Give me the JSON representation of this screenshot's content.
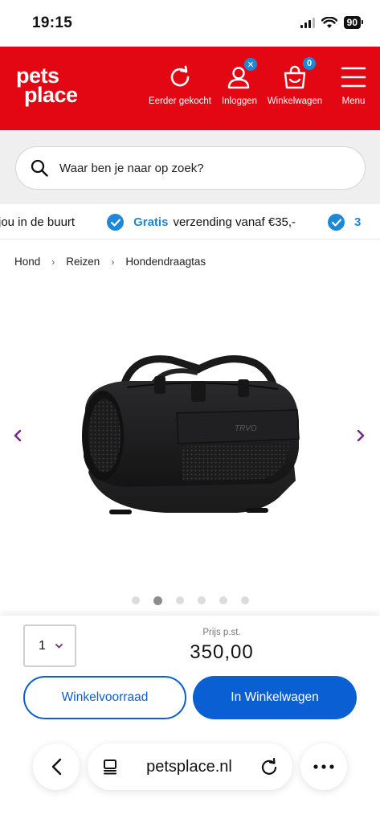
{
  "status_bar": {
    "time": "19:15",
    "battery": "90"
  },
  "header": {
    "logo_line1": "pets",
    "logo_line2": "place",
    "items": [
      {
        "label": "Eerder gekocht",
        "icon": "refresh-icon"
      },
      {
        "label": "Inloggen",
        "icon": "user-icon",
        "badge": "✕"
      },
      {
        "label": "Winkelwagen",
        "icon": "bag-icon",
        "badge": "0"
      },
      {
        "label": "Menu",
        "icon": "hamburger-icon"
      }
    ],
    "brand_color": "#e30613",
    "badge_color": "#1e88d8"
  },
  "search": {
    "placeholder": "Waar ben je naar op zoek?"
  },
  "usp": {
    "fragment_left": "jou in de buurt",
    "highlight": "Gratis",
    "text": "verzending vanaf €35,-",
    "fragment_right": "3"
  },
  "breadcrumb": [
    "Hond",
    "Reizen",
    "Hondendraagtas"
  ],
  "product": {
    "brand_mark": "TRVO",
    "gallery_dots": 6,
    "active_dot": 2
  },
  "buy": {
    "quantity": "1",
    "price_label": "Prijs p.st.",
    "price": "350,00",
    "stock_button": "Winkelvoorraad",
    "cart_button": "In Winkelwagen",
    "primary_color": "#0a5fd2"
  },
  "browser": {
    "url": "petsplace.nl"
  }
}
